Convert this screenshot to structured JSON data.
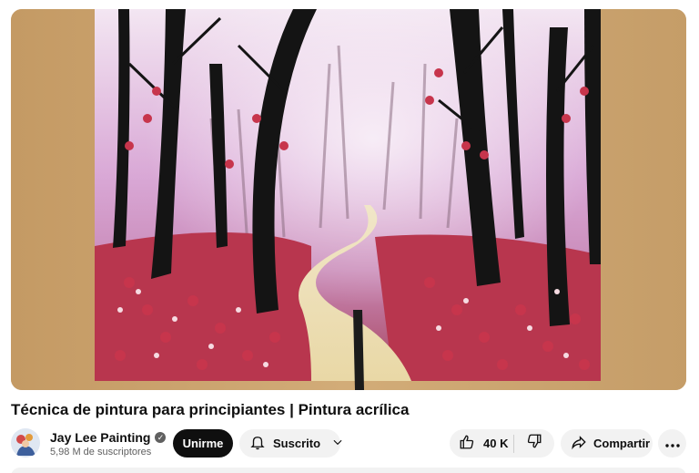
{
  "video": {
    "thumbnail_description_icon": "painting-canvas",
    "colors": {
      "wood": "#c9a370",
      "sky": "#e7c8e4",
      "petals": "#c7354c",
      "trunk": "#141414"
    }
  },
  "title": "Técnica de pintura para principiantes | Pintura acrílica",
  "channel": {
    "name": "Jay Lee Painting",
    "subscribers": "5,98 M de suscriptores",
    "verified_icon": "verified-check-icon"
  },
  "actions": {
    "join_label": "Unirme",
    "subscribe_label": "Suscrito",
    "like_count": "40 K",
    "share_label": "Compartir"
  },
  "icons": {
    "bell": "bell-icon",
    "chevron": "chevron-down-icon",
    "like": "thumbs-up-icon",
    "dislike": "thumbs-down-icon",
    "share": "share-arrow-icon",
    "more": "more-horizontal-icon"
  }
}
